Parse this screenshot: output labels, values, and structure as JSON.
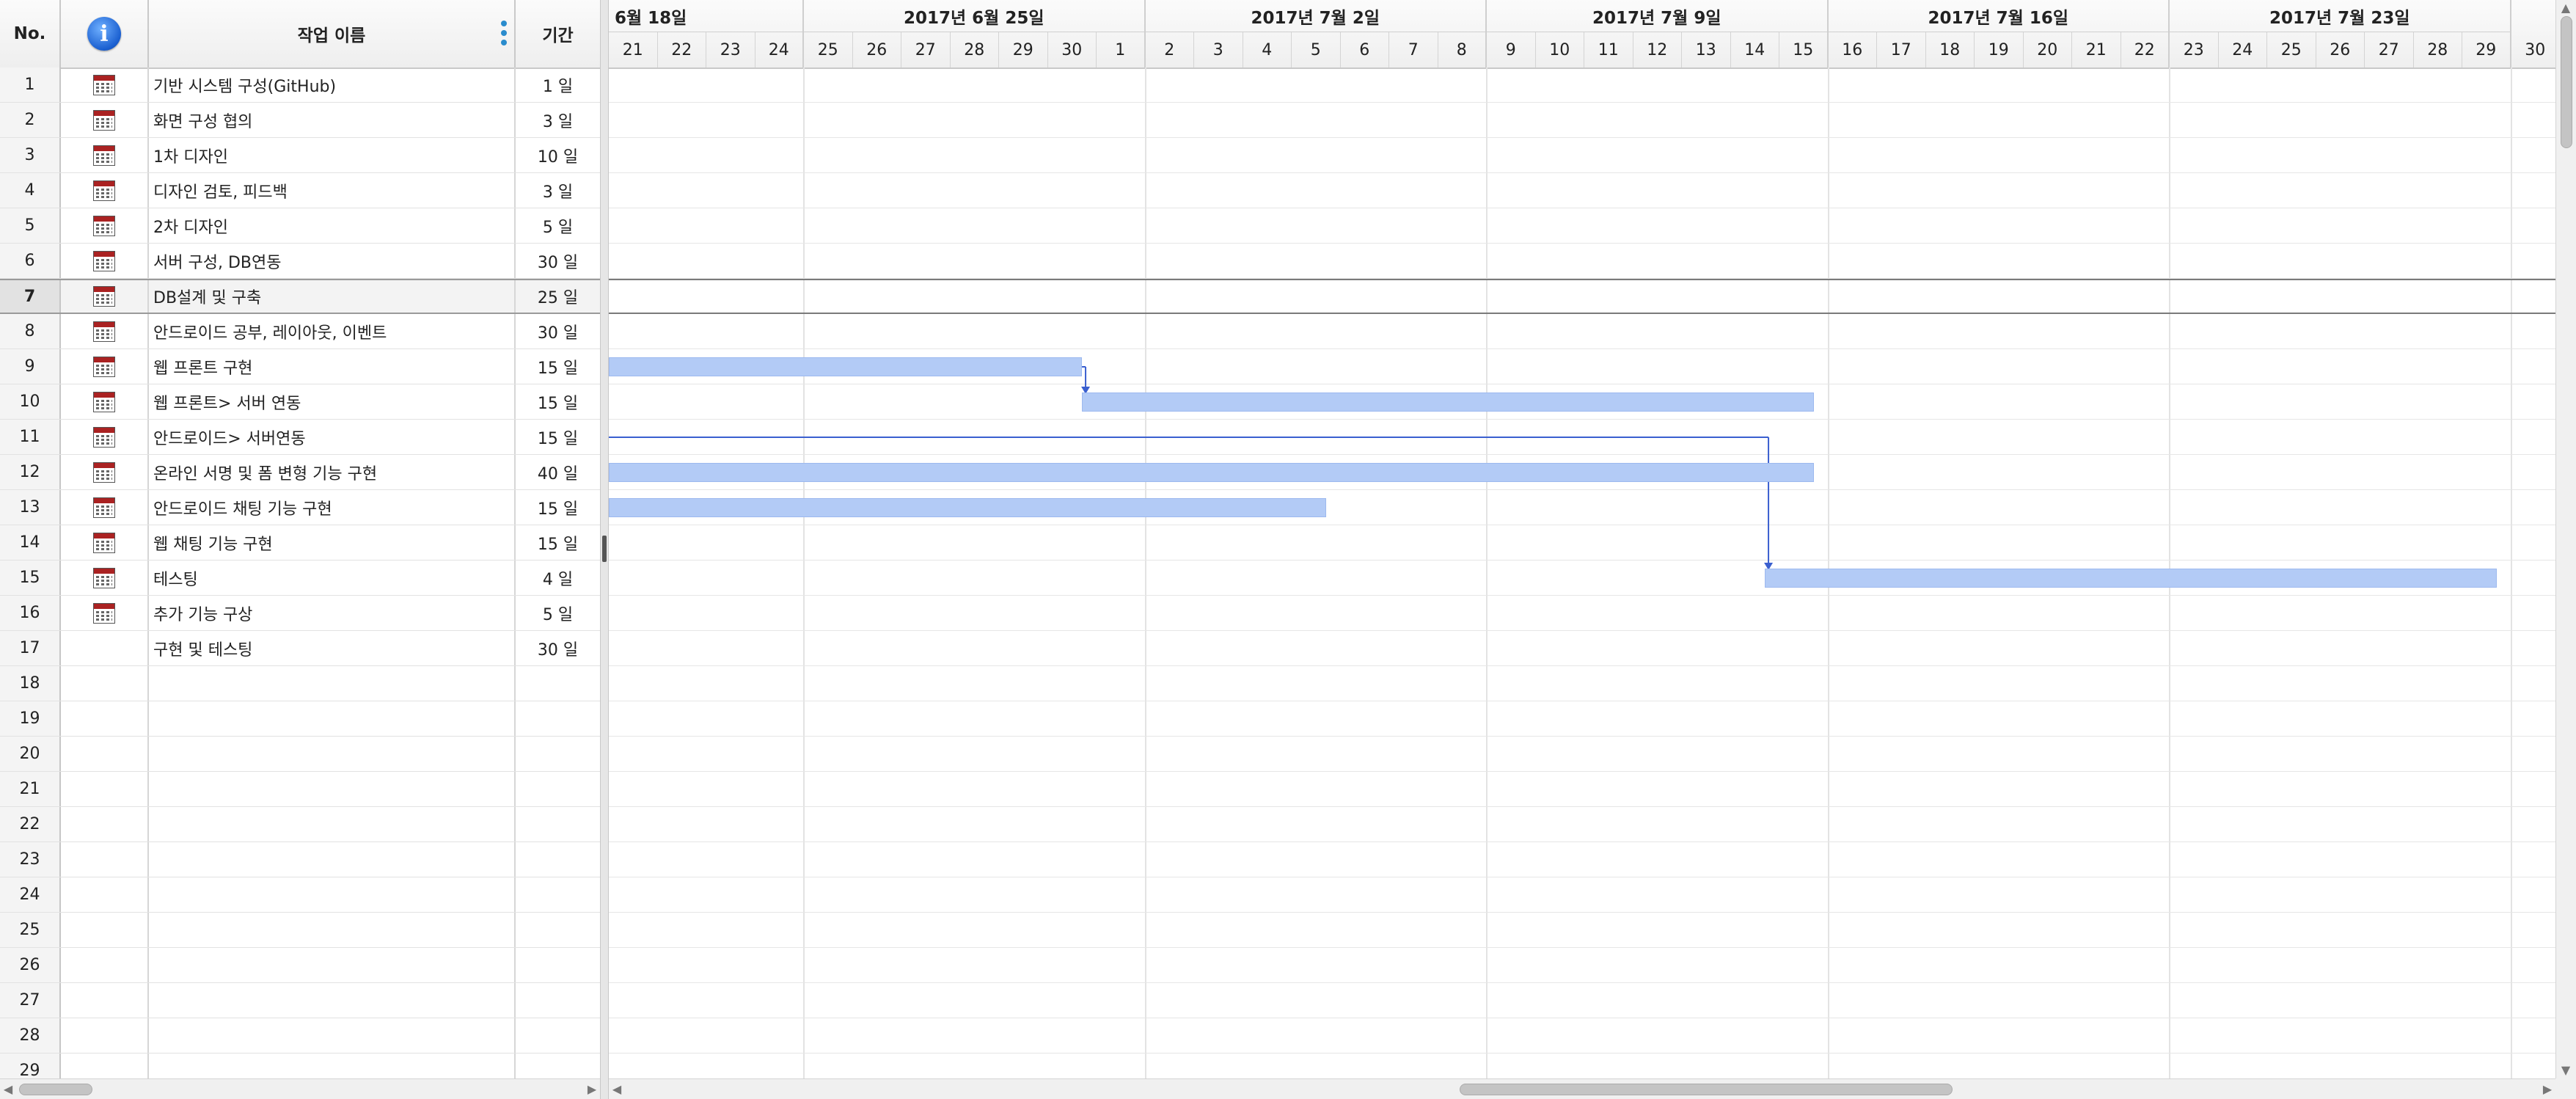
{
  "table": {
    "headers": {
      "no": "No.",
      "info_icon": "info-icon",
      "name": "작업 이름",
      "duration": "기간"
    },
    "rows": [
      {
        "no": "1",
        "name": "기반 시스템 구성(GitHub)",
        "duration": "1 일",
        "icon": "calendar-icon"
      },
      {
        "no": "2",
        "name": "화면 구성 협의",
        "duration": "3 일",
        "icon": "calendar-icon"
      },
      {
        "no": "3",
        "name": "1차 디자인",
        "duration": "10 일",
        "icon": "calendar-icon"
      },
      {
        "no": "4",
        "name": "디자인 검토, 피드백",
        "duration": "3 일",
        "icon": "calendar-icon"
      },
      {
        "no": "5",
        "name": "2차 디자인",
        "duration": "5 일",
        "icon": "calendar-icon"
      },
      {
        "no": "6",
        "name": "서버 구성, DB연동",
        "duration": "30 일",
        "icon": "calendar-icon"
      },
      {
        "no": "7",
        "name": "DB설계 및 구축",
        "duration": "25 일",
        "icon": "calendar-icon",
        "selected": true
      },
      {
        "no": "8",
        "name": "안드로이드 공부, 레이아웃, 이벤트",
        "duration": "30 일",
        "icon": "calendar-icon"
      },
      {
        "no": "9",
        "name": "웹 프론트 구현",
        "duration": "15 일",
        "icon": "calendar-icon"
      },
      {
        "no": "10",
        "name": "웹 프론트> 서버 연동",
        "duration": "15 일",
        "icon": "calendar-icon"
      },
      {
        "no": "11",
        "name": "안드로이드> 서버연동",
        "duration": "15 일",
        "icon": "calendar-icon"
      },
      {
        "no": "12",
        "name": "온라인 서명 및 폼 변형 기능 구현",
        "duration": "40 일",
        "icon": "calendar-icon"
      },
      {
        "no": "13",
        "name": "안드로이드 채팅 기능 구현",
        "duration": "15 일",
        "icon": "calendar-icon"
      },
      {
        "no": "14",
        "name": "웹 채팅 기능 구현",
        "duration": "15 일",
        "icon": "calendar-icon"
      },
      {
        "no": "15",
        "name": "테스팅",
        "duration": "4 일",
        "icon": "calendar-icon"
      },
      {
        "no": "16",
        "name": "추가 기능 구상",
        "duration": "5 일",
        "icon": "calendar-icon"
      },
      {
        "no": "17",
        "name": "구현 및 테스팅",
        "duration": "30 일",
        "icon": ""
      },
      {
        "no": "18",
        "name": "",
        "duration": "",
        "icon": ""
      },
      {
        "no": "19",
        "name": "",
        "duration": "",
        "icon": ""
      },
      {
        "no": "20",
        "name": "",
        "duration": "",
        "icon": ""
      },
      {
        "no": "21",
        "name": "",
        "duration": "",
        "icon": ""
      },
      {
        "no": "22",
        "name": "",
        "duration": "",
        "icon": ""
      },
      {
        "no": "23",
        "name": "",
        "duration": "",
        "icon": ""
      },
      {
        "no": "24",
        "name": "",
        "duration": "",
        "icon": ""
      },
      {
        "no": "25",
        "name": "",
        "duration": "",
        "icon": ""
      },
      {
        "no": "26",
        "name": "",
        "duration": "",
        "icon": ""
      },
      {
        "no": "27",
        "name": "",
        "duration": "",
        "icon": ""
      },
      {
        "no": "28",
        "name": "",
        "duration": "",
        "icon": ""
      },
      {
        "no": "29",
        "name": "",
        "duration": "",
        "icon": ""
      }
    ]
  },
  "timeline": {
    "weeks": [
      "6월 18일",
      "2017년 6월 25일",
      "2017년 7월 2일",
      "2017년 7월 9일",
      "2017년 7월 16일",
      "2017년 7월 23일"
    ],
    "days": [
      "21",
      "22",
      "23",
      "24",
      "25",
      "26",
      "27",
      "28",
      "29",
      "30",
      "1",
      "2",
      "3",
      "4",
      "5",
      "6",
      "7",
      "8",
      "9",
      "10",
      "11",
      "12",
      "13",
      "14",
      "15",
      "16",
      "17",
      "18",
      "19",
      "20",
      "21",
      "22",
      "23",
      "24",
      "25",
      "26",
      "27",
      "28",
      "29",
      "30"
    ],
    "bars": [
      {
        "row": 9,
        "start_day": 0,
        "end_day": 9.7
      },
      {
        "row": 10,
        "start_day": 9.7,
        "end_day": 24.7
      },
      {
        "row": 12,
        "start_day": 0,
        "end_day": 24.7
      },
      {
        "row": 13,
        "start_day": 0,
        "end_day": 14.7
      },
      {
        "row": 15,
        "start_day": 23.7,
        "end_day": 38.7
      }
    ],
    "links": [
      {
        "from_row": 9,
        "to_row": 10,
        "at_day": 9.7
      },
      {
        "from_row": 11,
        "to_row": 15,
        "at_day": 23.7,
        "start_day": 0
      }
    ],
    "selected_row": 7
  },
  "colors": {
    "bar": "#b3cbf6",
    "link": "#3a5fcf"
  }
}
